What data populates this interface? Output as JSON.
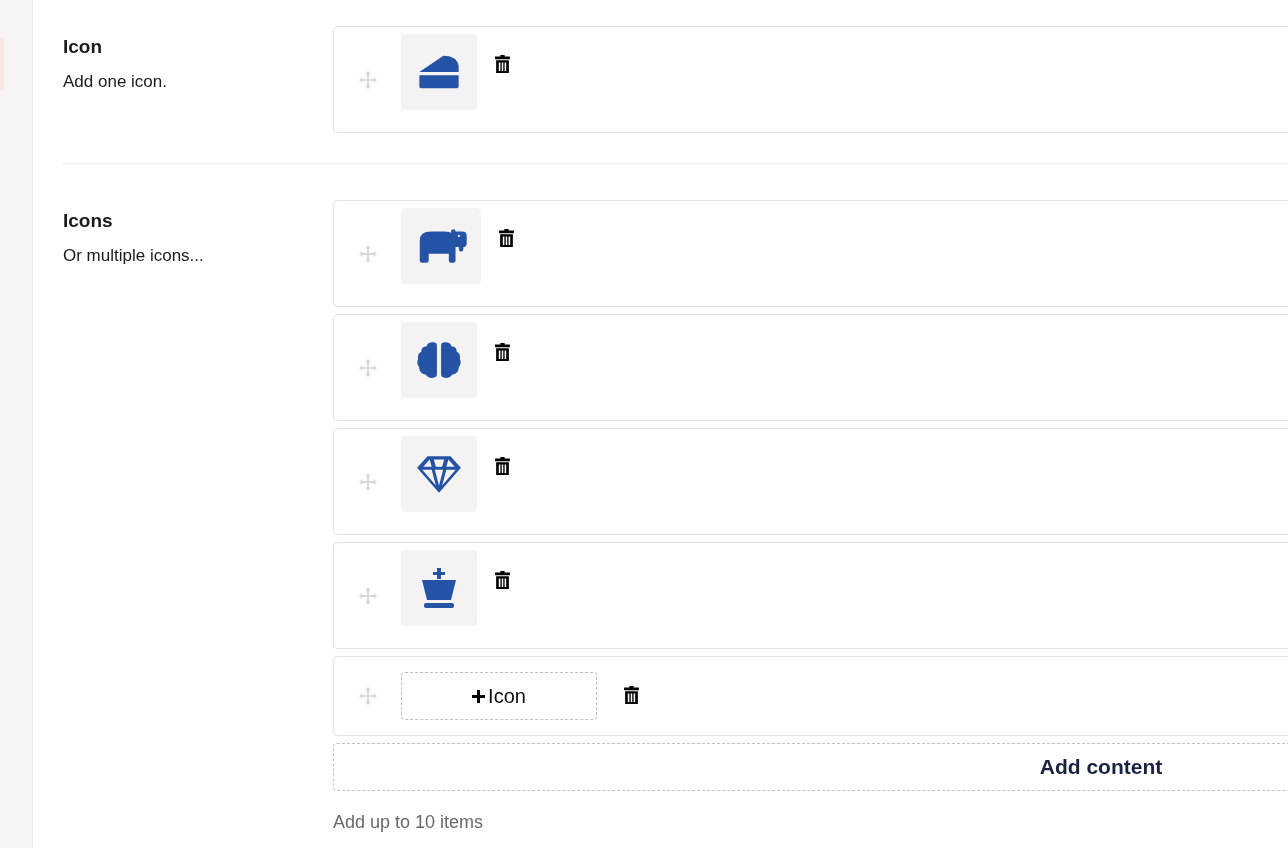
{
  "sections": [
    {
      "title": "Icon",
      "description": "Add one icon.",
      "items": [
        {
          "kind": "cheese"
        }
      ]
    },
    {
      "title": "Icons",
      "description": "Or multiple icons...",
      "items": [
        {
          "kind": "hippo"
        },
        {
          "kind": "brain"
        },
        {
          "kind": "gem"
        },
        {
          "kind": "chess-king"
        },
        {
          "kind": "empty",
          "button": "Icon"
        }
      ],
      "add_button": "Add content",
      "hint": "Add up to 10 items"
    }
  ]
}
